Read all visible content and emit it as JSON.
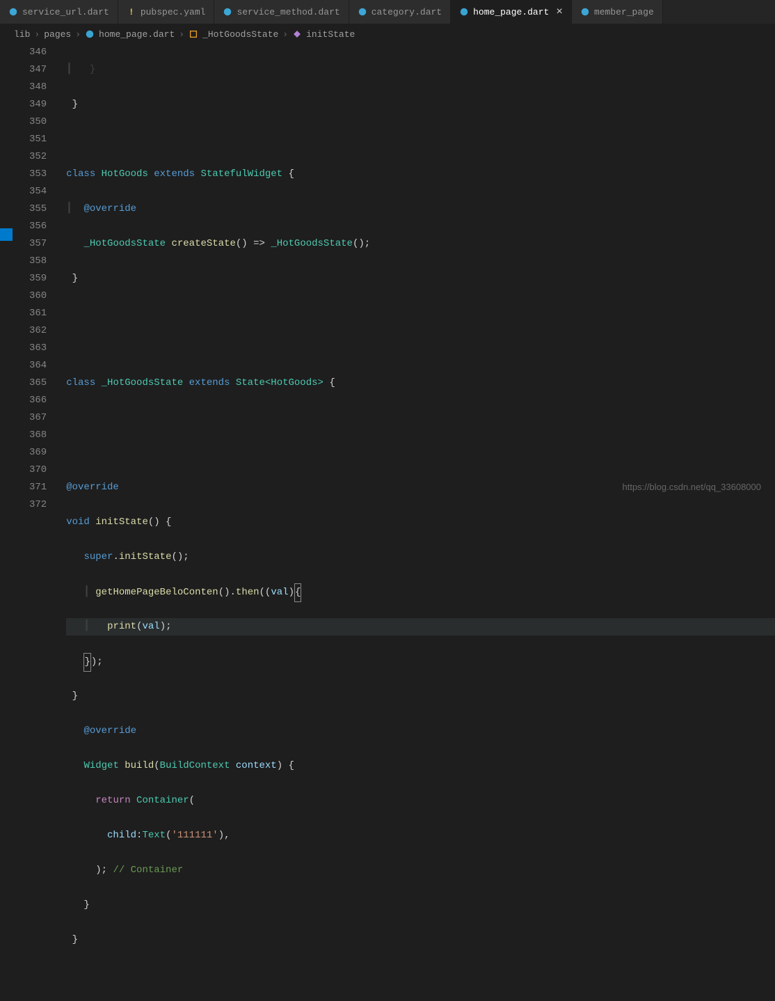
{
  "tabs": [
    {
      "name": "service_url.dart",
      "icon": "dart",
      "active": false
    },
    {
      "name": "pubspec.yaml",
      "icon": "yaml",
      "active": false
    },
    {
      "name": "service_method.dart",
      "icon": "dart",
      "active": false
    },
    {
      "name": "category.dart",
      "icon": "dart",
      "active": false
    },
    {
      "name": "home_page.dart",
      "icon": "dart",
      "active": true,
      "close": "×"
    },
    {
      "name": "member_page",
      "icon": "dart",
      "active": false
    }
  ],
  "breadcrumb": {
    "segments": [
      "lib",
      "pages",
      "home_page.dart",
      "_HotGoodsState",
      "initState"
    ],
    "separator": "›"
  },
  "lineNumbers": [
    "346",
    "347",
    "348",
    "349",
    "350",
    "351",
    "352",
    "353",
    "354",
    "355",
    "356",
    "357",
    "358",
    "359",
    "360",
    "361",
    "362",
    "363",
    "364",
    "365",
    "366",
    "367",
    "368",
    "369",
    "370",
    "371",
    "372"
  ],
  "code": {
    "l346": "┃   }",
    "l347": " }",
    "l348": "",
    "l349_class": "class",
    "l349_name": " HotGoods ",
    "l349_extends": "extends",
    "l349_parent": " StatefulWidget ",
    "l349_brace": "{",
    "l350_indent": "┃  ",
    "l350_annot": "@override",
    "l351_indent": "   ",
    "l351_type": "_HotGoodsState ",
    "l351_method": "createState",
    "l351_rest": "() => ",
    "l351_call": "_HotGoodsState",
    "l351_end": "();",
    "l352": " }",
    "l353": "",
    "l354": "",
    "l355_class": "class",
    "l355_name": " _HotGoodsState ",
    "l355_extends": "extends",
    "l355_state": " State",
    "l355_generic": "<HotGoods> ",
    "l355_brace": "{",
    "l356": "",
    "l357": "",
    "l358_annot": "@override",
    "l359_void": "void",
    "l359_method": " initState",
    "l359_rest": "() {",
    "l360_indent": "   ",
    "l360_super": "super",
    "l360_dot": ".",
    "l360_method": "initState",
    "l360_end": "();",
    "l361_indent": "   ┃ ",
    "l361_func": "getHomePageBeloConten",
    "l361_paren": "().",
    "l361_then": "then",
    "l361_arrow": "((",
    "l361_param": "val",
    "l361_end": ")",
    "l361_brace": "{",
    "l362_indent": "   ┃   ",
    "l362_print": "print",
    "l362_open": "(",
    "l362_param": "val",
    "l362_end": ");",
    "l363_indent": "   ",
    "l363_brace": "}",
    "l363_end": ");",
    "l364": " }",
    "l365_indent": "   ",
    "l365_annot": "@override",
    "l366_indent": "   ",
    "l366_widget": "Widget ",
    "l366_method": "build",
    "l366_open": "(",
    "l366_type": "BuildContext",
    "l366_param": " context",
    "l366_end": ") {",
    "l367_indent": "     ",
    "l367_return": "return",
    "l367_container": " Container",
    "l367_end": "(",
    "l368_indent": "       ",
    "l368_child": "child",
    "l368_colon": ":",
    "l368_text": "Text",
    "l368_open": "(",
    "l368_str": "'111111'",
    "l368_end": "),",
    "l369_indent": "     ); ",
    "l369_comment": "// Container",
    "l370_indent": "   }",
    "l371": " }",
    "l372": ""
  },
  "watermark": "https://blog.csdn.net/qq_33608000"
}
